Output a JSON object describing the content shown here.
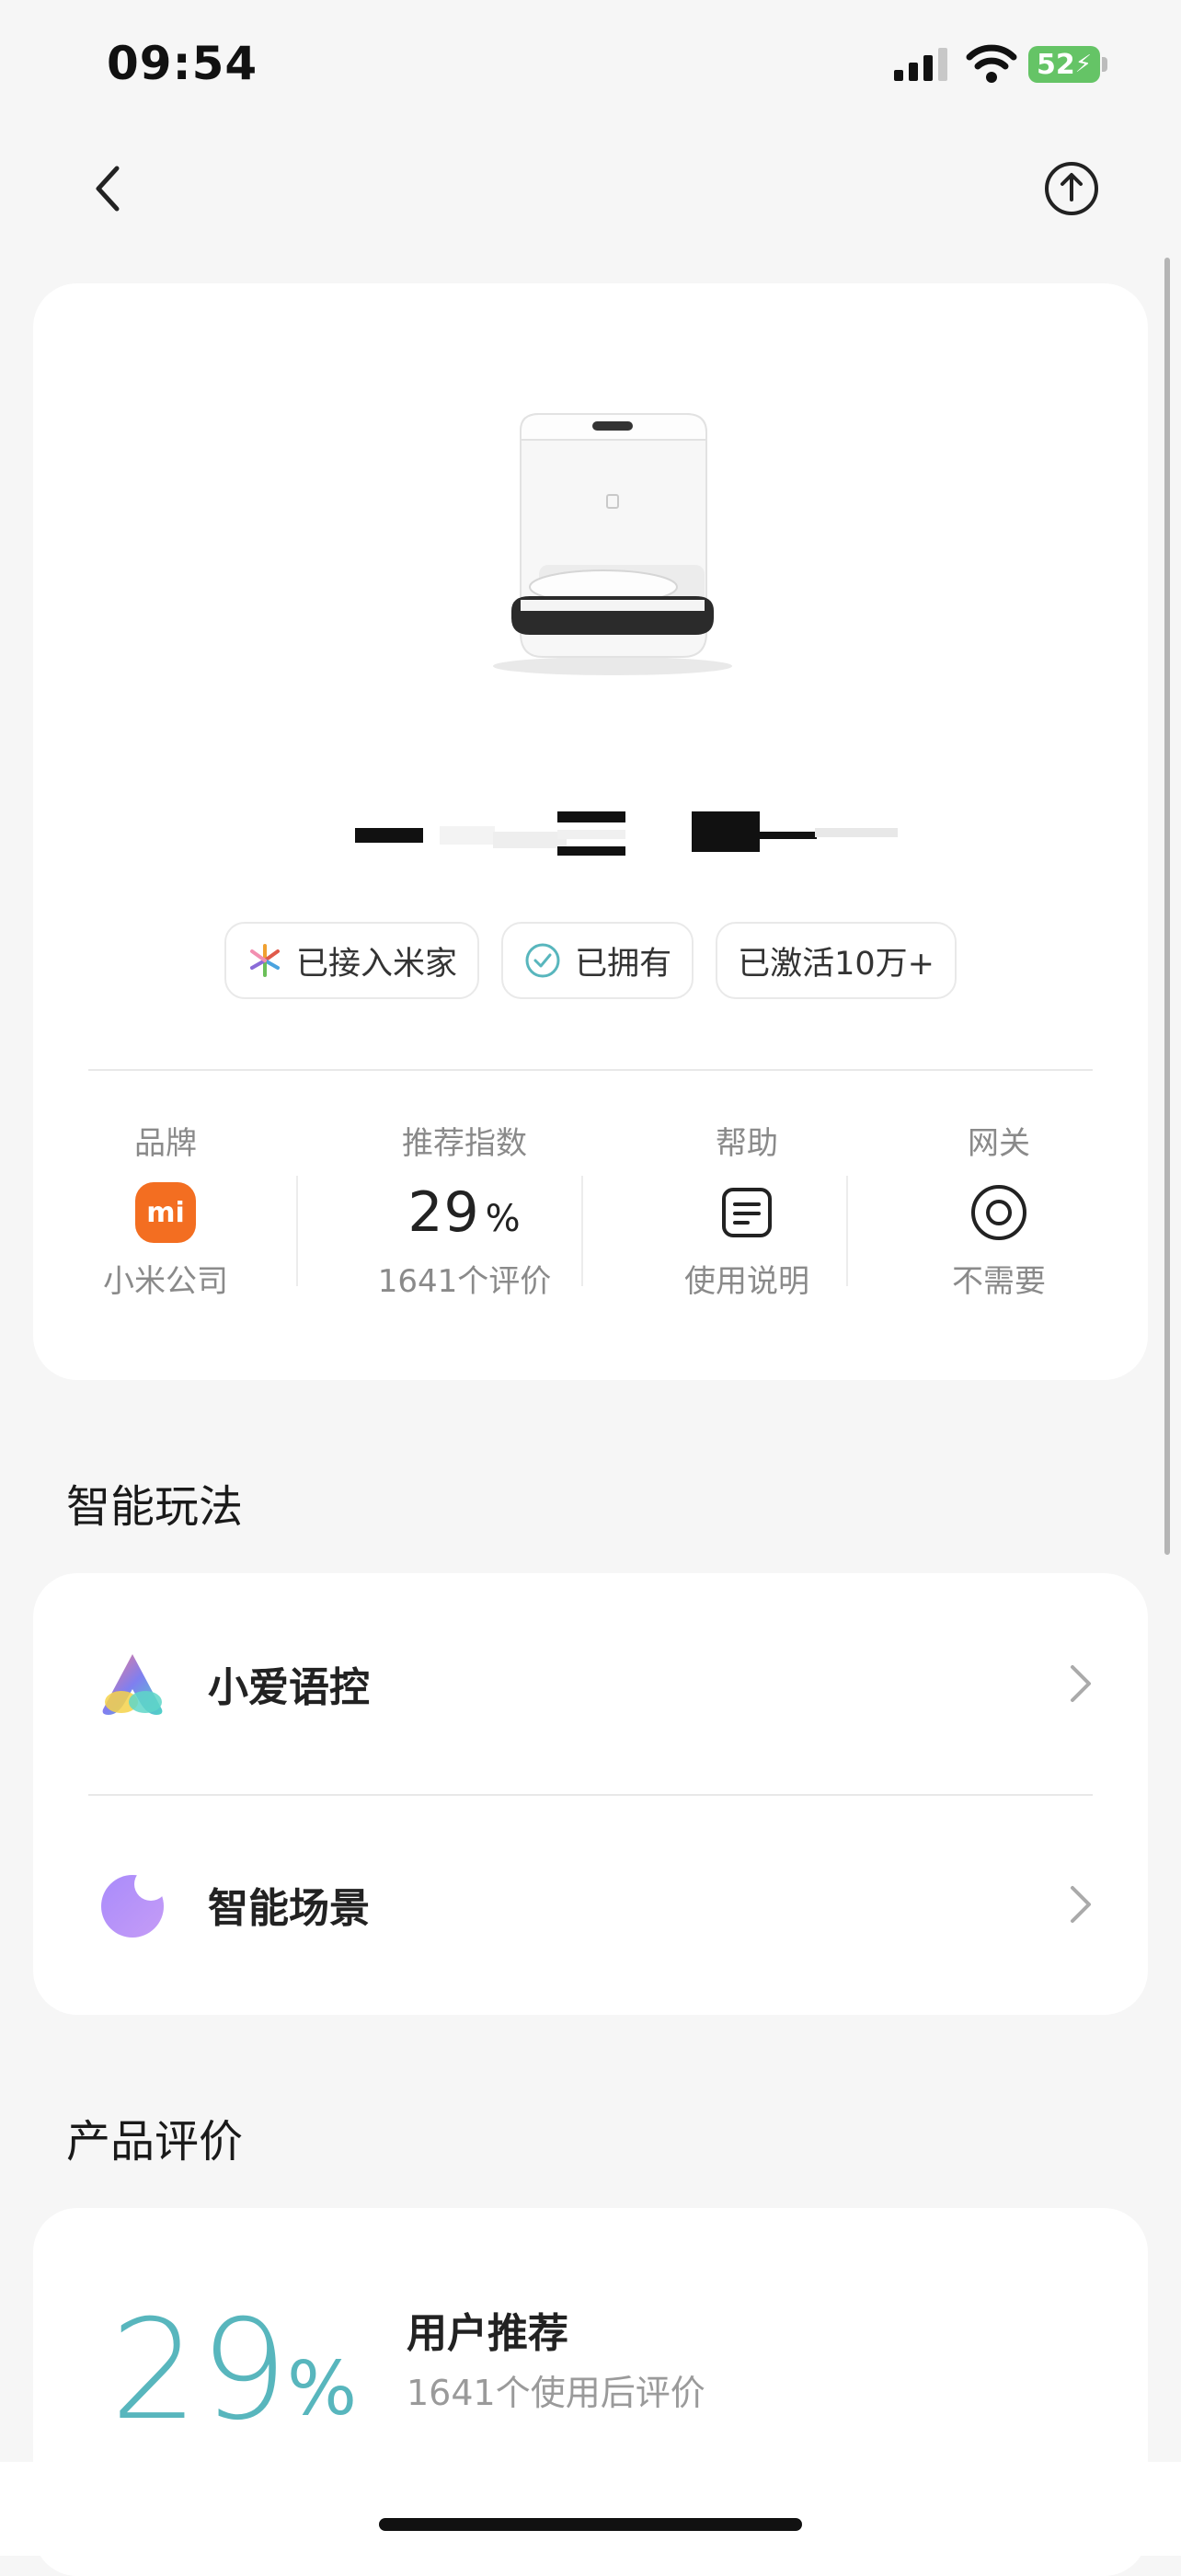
{
  "status_bar": {
    "time": "09:54",
    "battery": "52"
  },
  "badges": [
    {
      "label": "已接入米家",
      "icon": "mijia-flower-icon"
    },
    {
      "label": "已拥有",
      "icon": "check-circle-icon"
    },
    {
      "label": "已激活10万+"
    }
  ],
  "stats": {
    "brand": {
      "label": "品牌",
      "logo_text": "mi",
      "sub": "小米公司"
    },
    "recommend": {
      "label": "推荐指数",
      "value": "29",
      "unit": "%",
      "sub": "1641个评价"
    },
    "help": {
      "label": "帮助",
      "sub": "使用说明"
    },
    "gateway": {
      "label": "网关",
      "sub": "不需要"
    }
  },
  "smart": {
    "title": "智能玩法",
    "items": [
      {
        "label": "小爱语控",
        "icon": "xiaoai-icon"
      },
      {
        "label": "智能场景",
        "icon": "scene-moon-icon"
      }
    ]
  },
  "review": {
    "title": "产品评价",
    "score": "29",
    "unit": "%",
    "heading": "用户推荐",
    "sub": "1641个使用后评价"
  },
  "colors": {
    "accent": "#58b6bd",
    "mi_orange": "#f36e21",
    "battery_green": "#65c466"
  }
}
